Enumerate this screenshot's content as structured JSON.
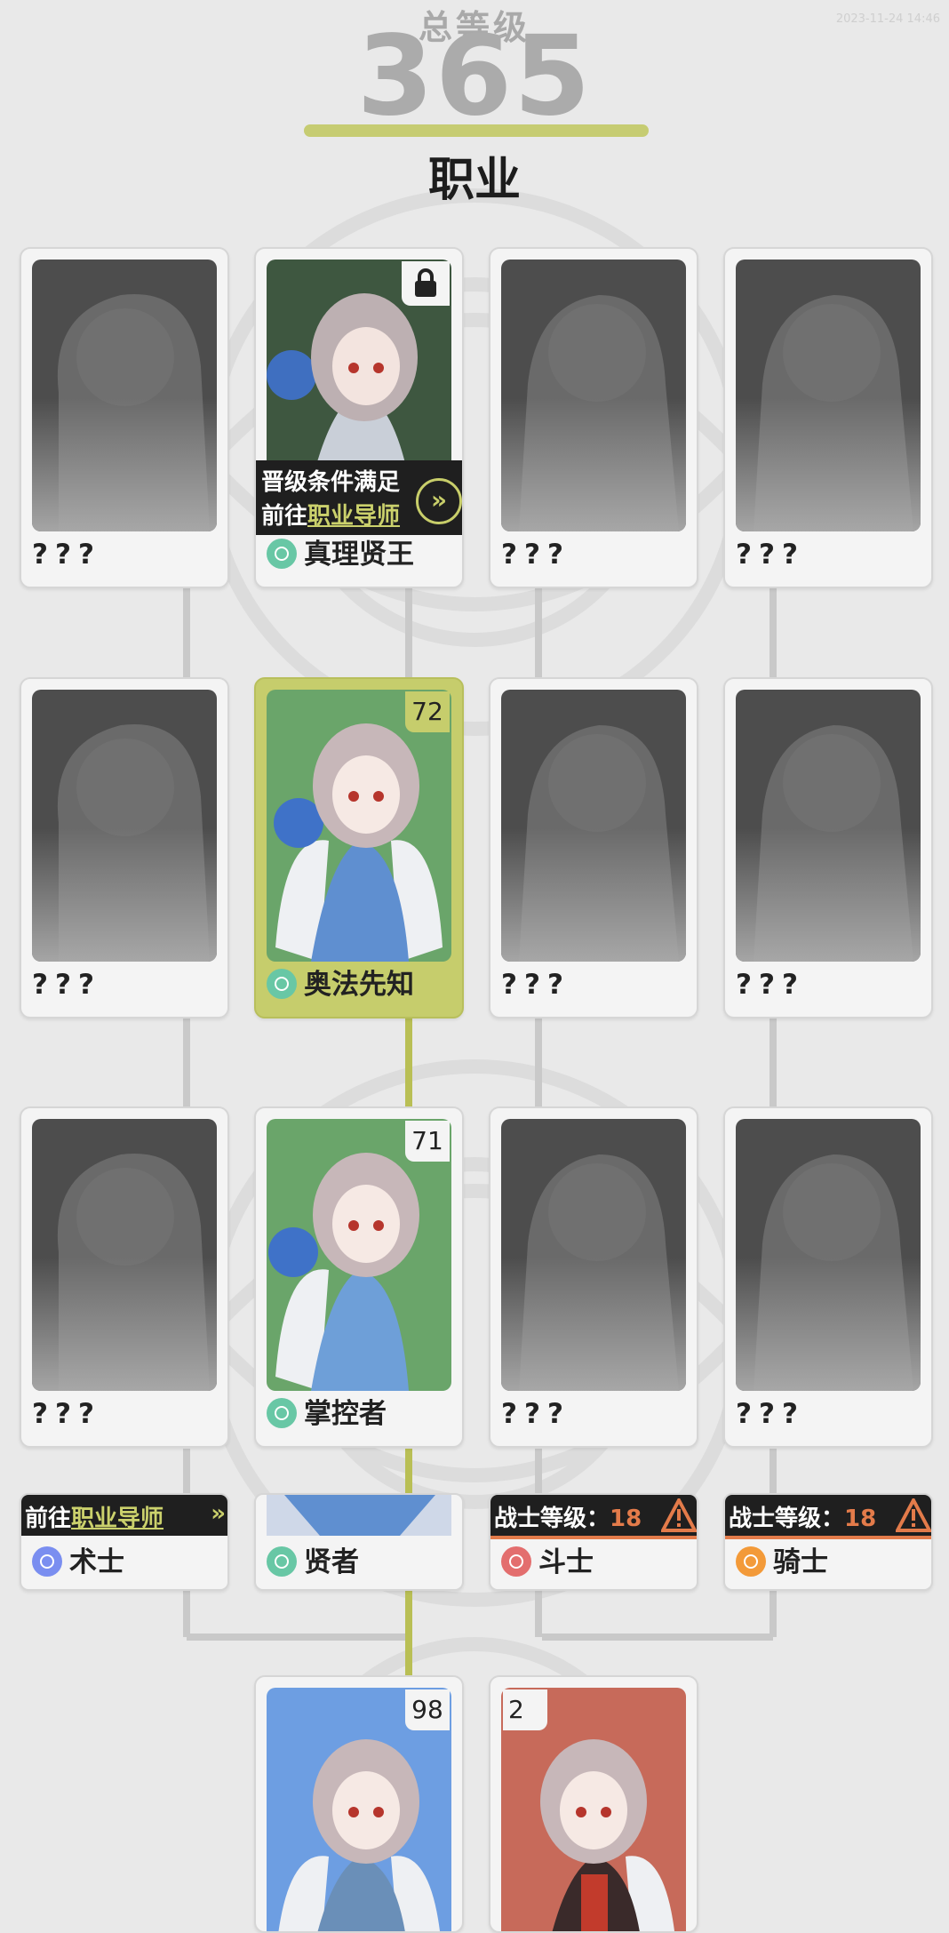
{
  "status": {
    "time": "2023-11-24 14:46"
  },
  "header": {
    "total_level_label": "总等级",
    "total_level_value": "365",
    "section_title": "职业",
    "accent_color": "#c6cc72"
  },
  "rows": [
    {
      "cards": [
        {
          "name": "???",
          "state": "unknown"
        },
        {
          "name": "真理贤王",
          "state": "locked",
          "icon": "job-teal-icon",
          "promo_line1": "晋级条件满足",
          "promo_line2_prefix": "前往",
          "promo_line2_link": "职业导师"
        },
        {
          "name": "???",
          "state": "unknown"
        },
        {
          "name": "???",
          "state": "unknown"
        }
      ]
    },
    {
      "cards": [
        {
          "name": "???",
          "state": "unknown"
        },
        {
          "name": "奥法先知",
          "state": "active",
          "level": "72",
          "icon": "job-teal-icon"
        },
        {
          "name": "???",
          "state": "unknown"
        },
        {
          "name": "???",
          "state": "unknown"
        }
      ]
    },
    {
      "cards": [
        {
          "name": "???",
          "state": "unknown"
        },
        {
          "name": "掌控者",
          "state": "unlocked",
          "level": "71",
          "icon": "job-teal-icon"
        },
        {
          "name": "???",
          "state": "unknown"
        },
        {
          "name": "???",
          "state": "unknown"
        }
      ]
    }
  ],
  "base_jobs": [
    {
      "name": "术士",
      "icon": "job-blue-icon",
      "strip_prefix": "前往",
      "strip_link": "职业导师"
    },
    {
      "name": "贤者",
      "icon": "job-teal-icon"
    },
    {
      "name": "斗士",
      "icon": "job-red-icon",
      "strip_label": "战士等级：",
      "strip_value": "18"
    },
    {
      "name": "骑士",
      "icon": "job-orange-icon",
      "strip_label": "战士等级：",
      "strip_value": "18"
    }
  ],
  "starter_jobs": [
    {
      "level": "98",
      "color": "#6d9ee2"
    },
    {
      "level": "2",
      "color": "#c76a5a"
    }
  ]
}
